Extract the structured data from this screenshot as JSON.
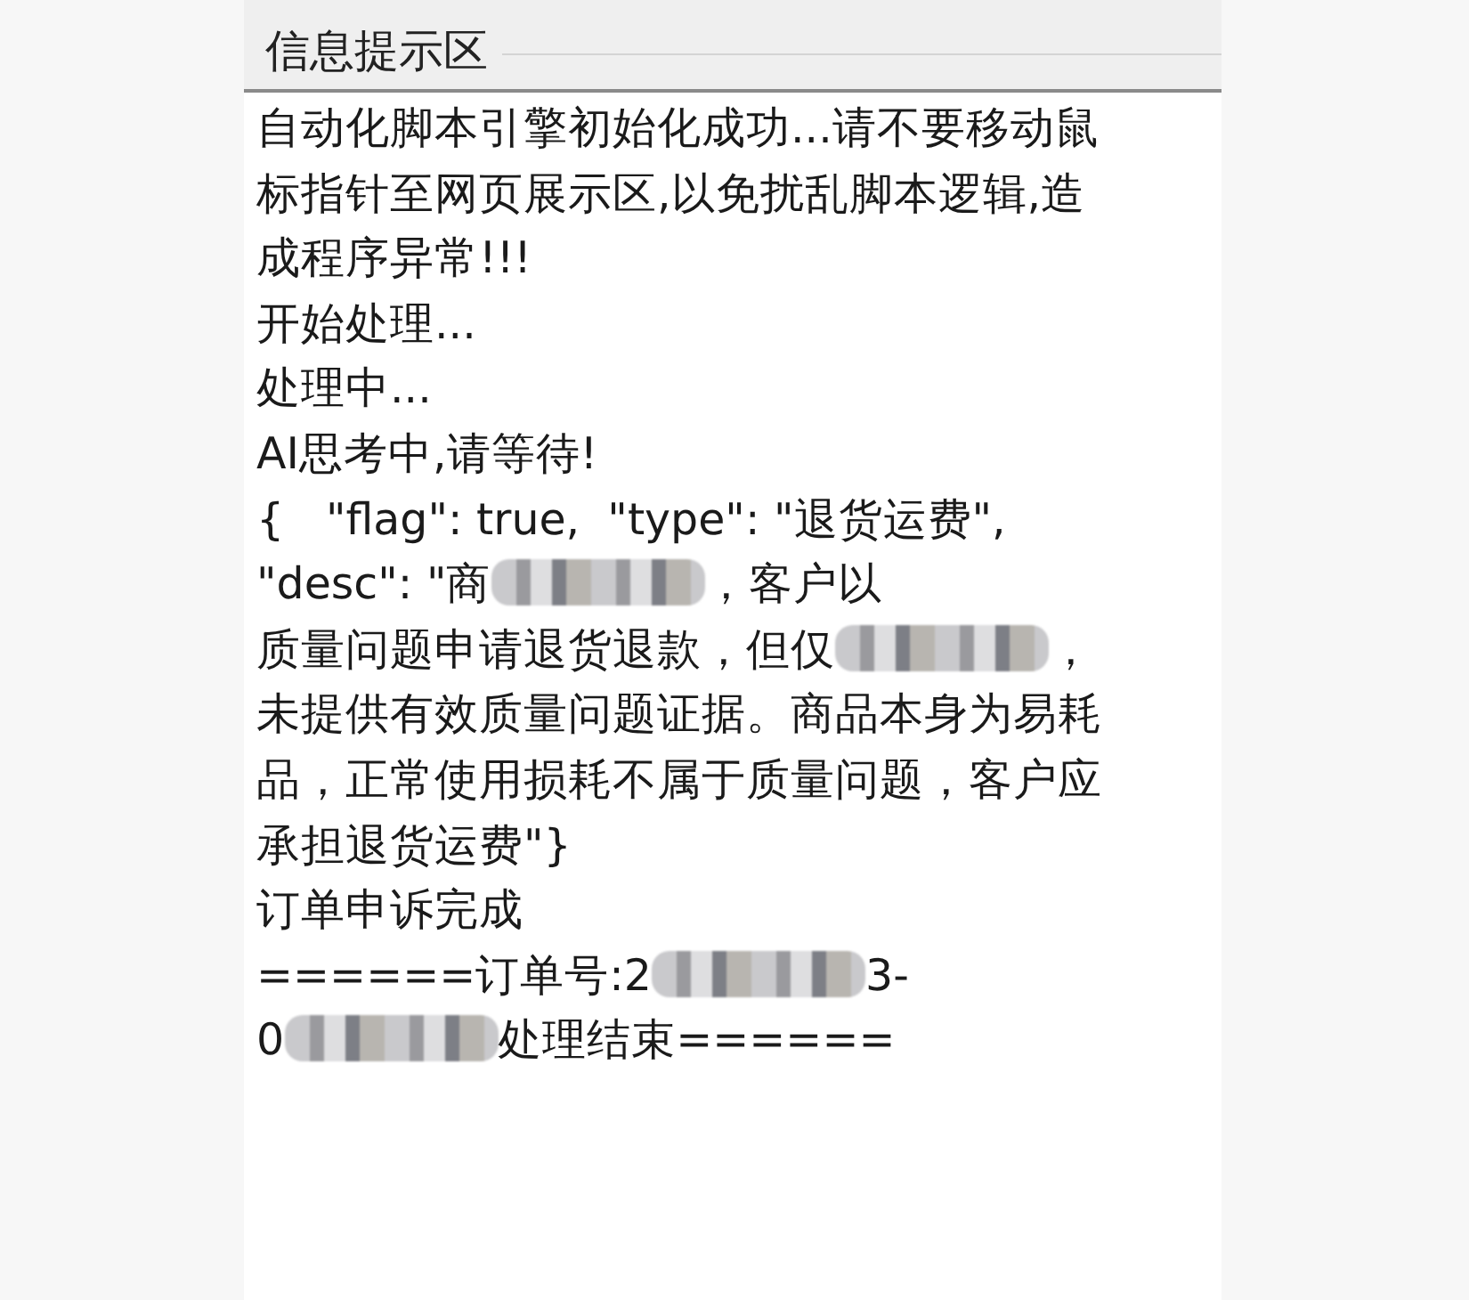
{
  "panel": {
    "title": "信息提示区"
  },
  "log": [
    [
      {
        "kind": "text",
        "text": "自动化脚本引擎初始化成功...请不要移动鼠"
      }
    ],
    [
      {
        "kind": "text",
        "text": "标指针至网页展示区,以免扰乱脚本逻辑,造"
      }
    ],
    [
      {
        "kind": "text",
        "text": "成程序异常!!!"
      }
    ],
    [
      {
        "kind": "text",
        "text": "开始处理..."
      }
    ],
    [
      {
        "kind": "text",
        "text": "处理中..."
      }
    ],
    [
      {
        "kind": "text",
        "text": "AI思考中,请等待!"
      }
    ],
    [
      {
        "kind": "text",
        "text": "{   \"flag\": true,  \"type\": \"退货运费\","
      }
    ],
    [
      {
        "kind": "text",
        "text": "\"desc\": \"商"
      },
      {
        "kind": "redacted"
      },
      {
        "kind": "text",
        "text": "，客户以"
      }
    ],
    [
      {
        "kind": "text",
        "text": "质量问题申请退货退款，但仅"
      },
      {
        "kind": "redacted"
      },
      {
        "kind": "text",
        "text": "，"
      }
    ],
    [
      {
        "kind": "text",
        "text": "未提供有效质量问题证据。商品本身为易耗"
      }
    ],
    [
      {
        "kind": "text",
        "text": "品，正常使用损耗不属于质量问题，客户应"
      }
    ],
    [
      {
        "kind": "text",
        "text": "承担退货运费\"}"
      }
    ],
    [
      {
        "kind": "text",
        "text": "订单申诉完成"
      }
    ],
    [
      {
        "kind": "text",
        "text": "======订单号:2"
      },
      {
        "kind": "redacted"
      },
      {
        "kind": "text",
        "text": "3-"
      }
    ],
    [
      {
        "kind": "text",
        "text": "0"
      },
      {
        "kind": "redacted"
      },
      {
        "kind": "text",
        "text": "处理结束======"
      }
    ]
  ]
}
